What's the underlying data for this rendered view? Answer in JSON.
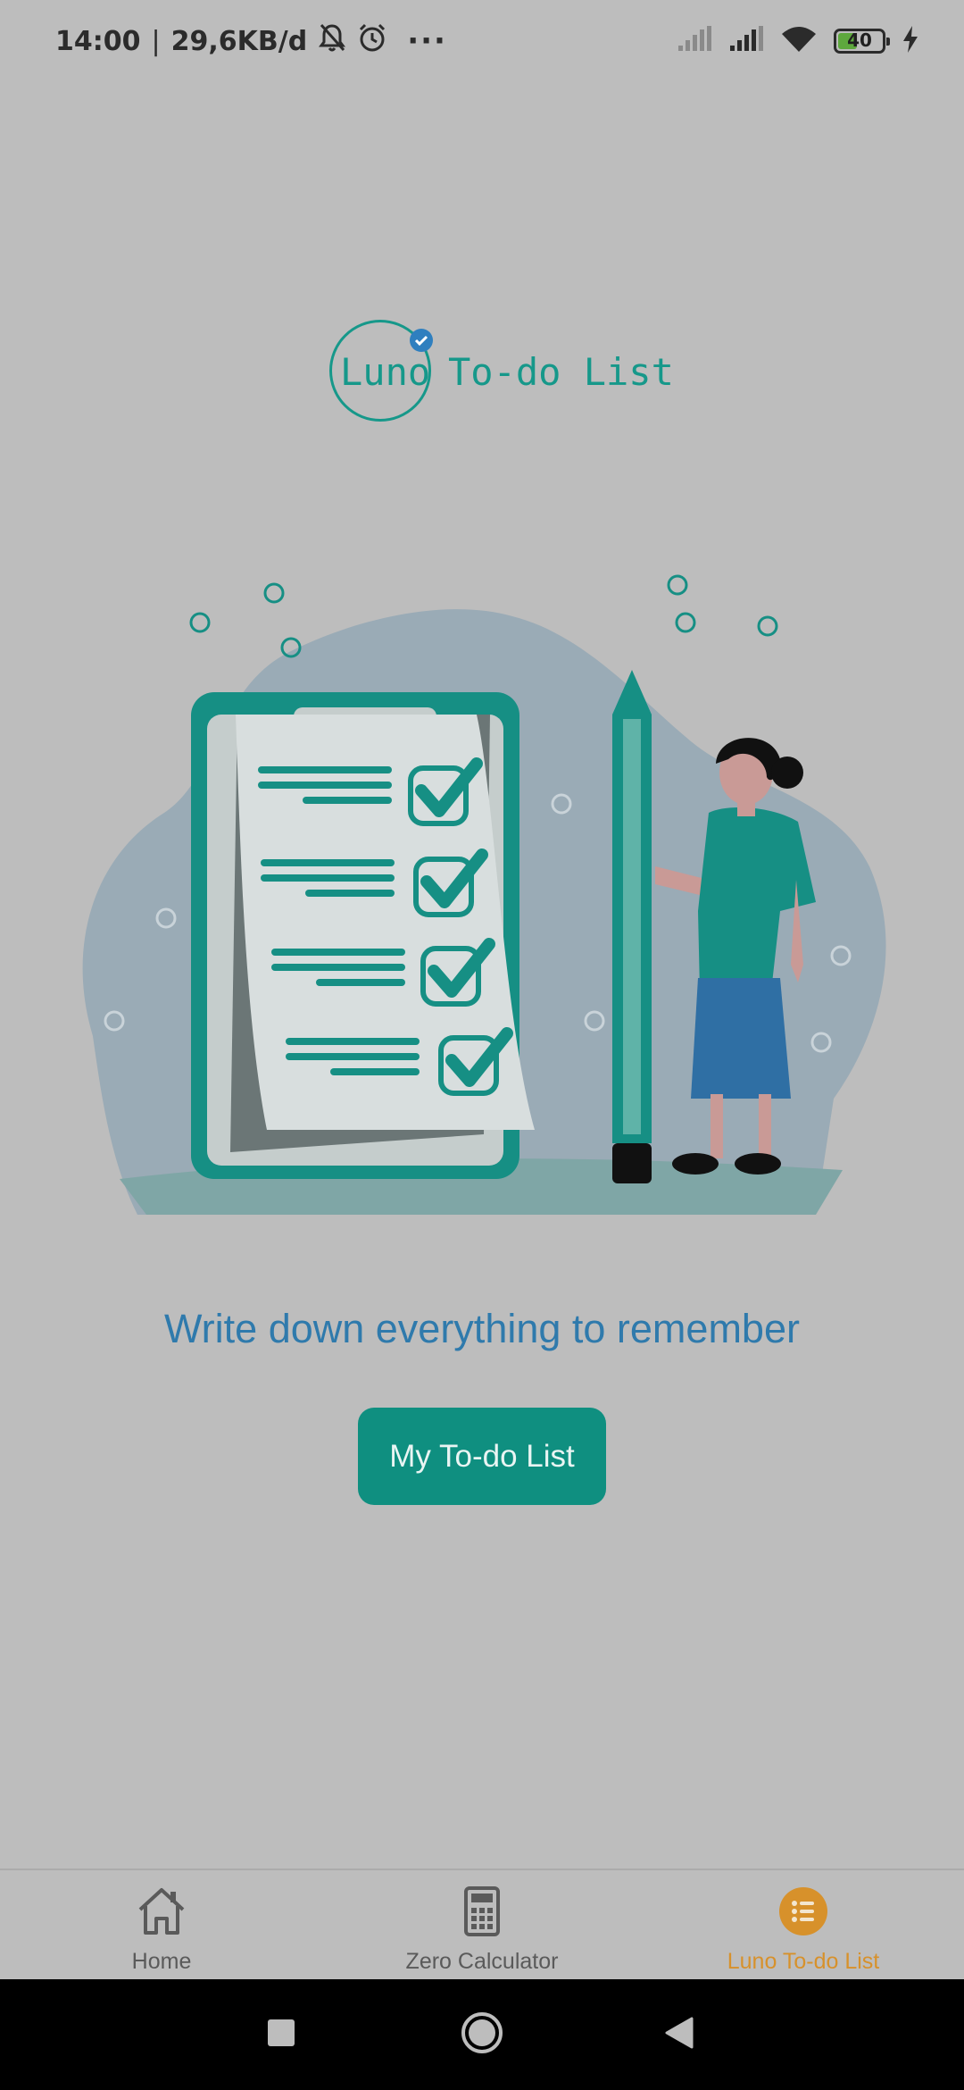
{
  "status_bar": {
    "time": "14:00",
    "separator": "|",
    "network_speed": "29,6KB/d",
    "more": "···",
    "battery_level": "40"
  },
  "logo": {
    "brand": "Luno",
    "title": "To-do List"
  },
  "tagline": "Write down everything to remember",
  "cta_label": "My To-do List",
  "bottom_nav": {
    "items": [
      {
        "label": "Home",
        "icon": "home-icon",
        "active": false
      },
      {
        "label": "Zero Calculator",
        "icon": "calculator-icon",
        "active": false
      },
      {
        "label": "Luno To-do List",
        "icon": "list-icon",
        "active": true
      }
    ],
    "active_color": "#d7912b"
  },
  "colors": {
    "background": "#bdbdbd",
    "brand_teal": "#0f8f80",
    "tagline_blue": "#2f7aac"
  }
}
